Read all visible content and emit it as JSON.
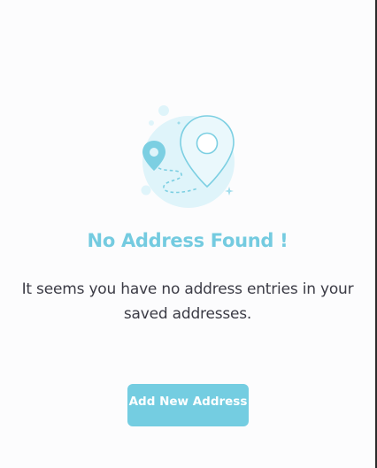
{
  "empty_state": {
    "illustration_icon": "map-location-pin-icon",
    "title": "No Address Found !",
    "message": "It seems you have no address entries in your saved addresses.",
    "button_label": "Add New Address"
  },
  "colors": {
    "accent": "#74cde1",
    "title": "#74cbe0",
    "text": "#3b3b45",
    "background": "#fcfcfd"
  }
}
